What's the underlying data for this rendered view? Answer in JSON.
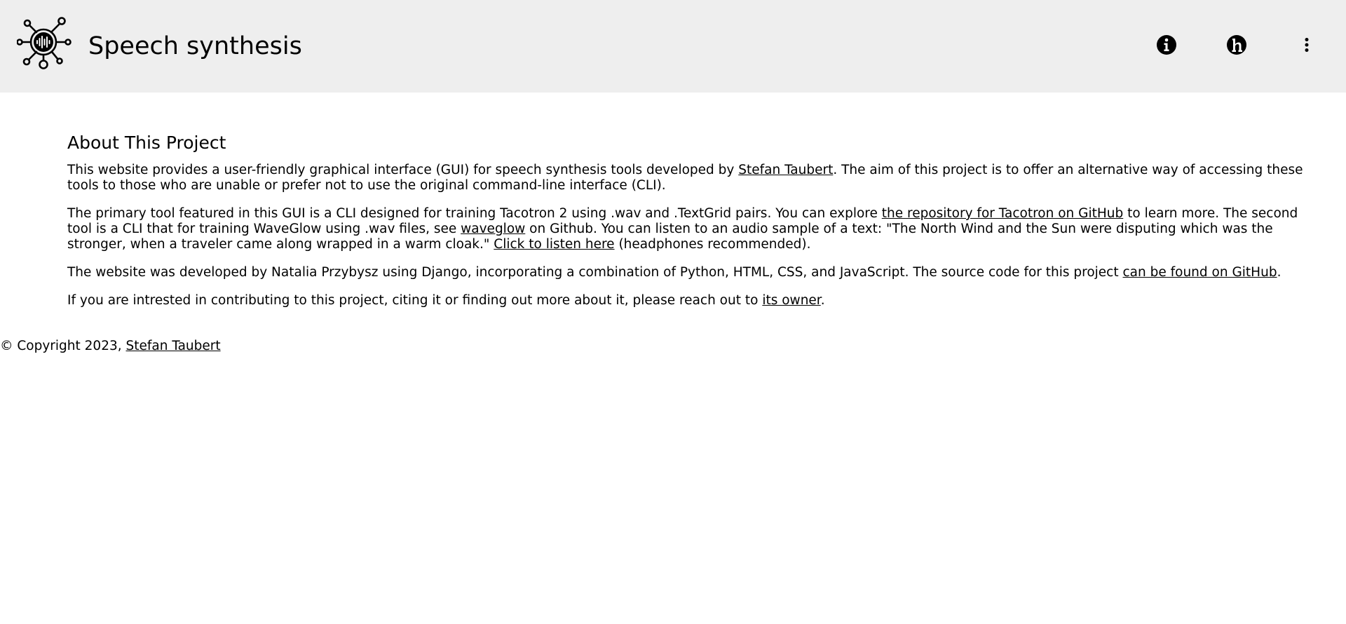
{
  "header": {
    "title": "Speech synthesis",
    "logo_icon": "speech-synthesis-network-icon",
    "info_icon": "info-circle-icon",
    "h_icon": "h-circle-icon",
    "more_icon": "vertical-ellipsis-icon"
  },
  "about": {
    "heading": "About This Project",
    "p1": {
      "l1_a": "This website provides a user-friendly graphical interface (GUI) for speech synthesis tools developed by ",
      "l1_link": "Stefan Taubert",
      "l1_b": ". The aim of this project is to offer an alternative way of accessing these",
      "l2": "tools to those who are unable or prefer not to use the original command-line interface (CLI)."
    },
    "p2": {
      "l1_a": "The primary tool featured in this GUI is a CLI designed for training Tacotron 2 using .wav and .TextGrid pairs. You can explore ",
      "l1_link": "the repository for Tacotron on GitHub",
      "l1_b": " to learn more. The second",
      "l2_a": "tool is a CLI that for training WaveGlow using .wav files, see ",
      "l2_link": "waveglow",
      "l2_b": " on Github. You can listen to an audio sample of a text: \"The North Wind and the Sun were disputing which was the",
      "l3_a": "stronger, when a traveler came along wrapped in a warm cloak.\" ",
      "l3_link": "Click to listen here",
      "l3_b": " (headphones recommended)."
    },
    "p3": {
      "a": "The website was developed by Natalia Przybysz using Django, incorporating a combination of Python, HTML, CSS, and JavaScript. The source code for this project ",
      "link": "can be found on GitHub",
      "b": "."
    },
    "p4": {
      "a": "If you are intrested in contributing to this project, citing it or finding out more about it, please reach out to ",
      "link": "its owner",
      "b": "."
    }
  },
  "footer": {
    "prefix": "© Copyright 2023, ",
    "link": "Stefan Taubert"
  },
  "colors": {
    "header_bg": "#eeeeee",
    "page_bg": "#ffffff",
    "text": "#000000"
  }
}
